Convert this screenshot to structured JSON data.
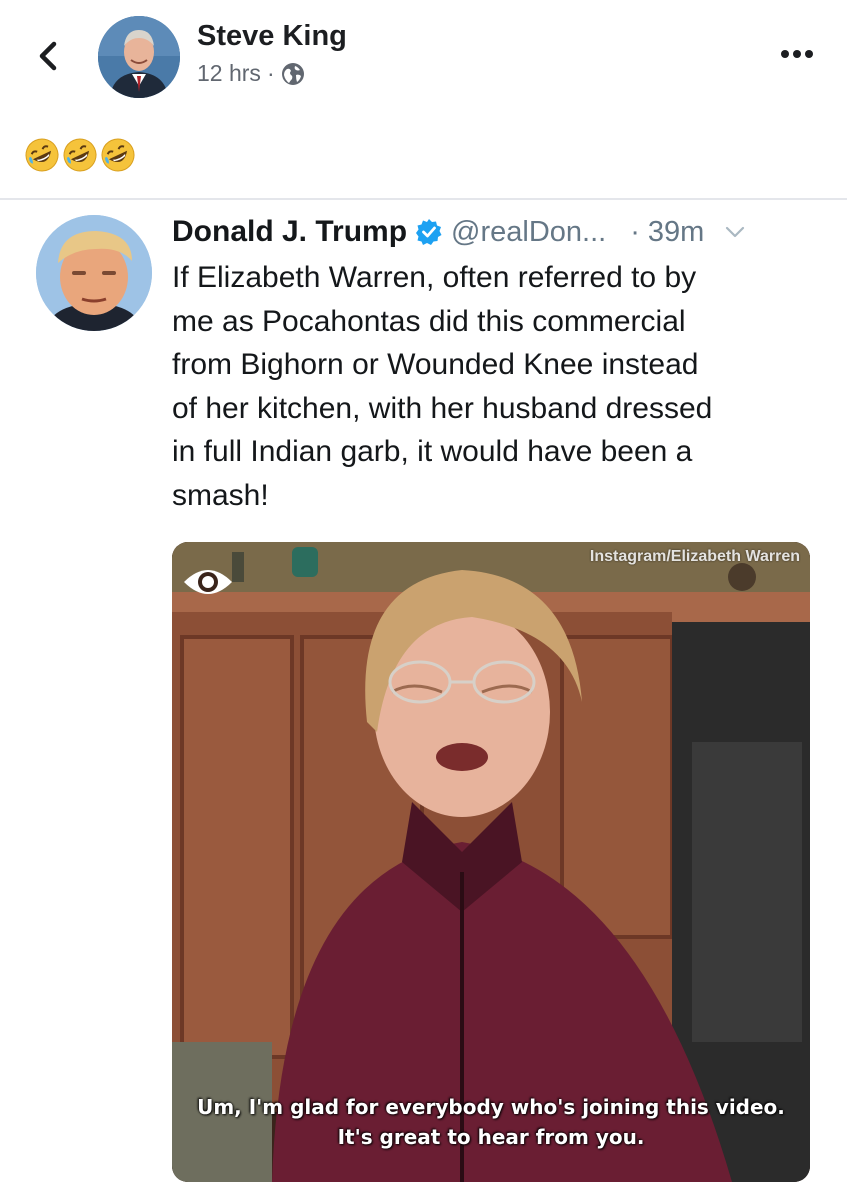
{
  "post": {
    "author": "Steve King",
    "time": "12 hrs",
    "separator": "·",
    "emojis": [
      "rolling-on-floor-laughing",
      "rolling-on-floor-laughing",
      "rolling-on-floor-laughing"
    ]
  },
  "icons": {
    "back": "chevron-left-icon",
    "privacy": "globe-icon",
    "more": "more-dots-icon",
    "verified": "verified-badge-icon",
    "menu": "chevron-down-icon"
  },
  "tweet": {
    "name": "Donald J. Trump",
    "handle": "@realDon...",
    "time": "· 39m",
    "text": "If Elizabeth Warren, often referred to by\nme as Pocahontas did this commercial\nfrom Bighorn or Wounded Knee instead\nof her kitchen, with her husband dressed\nin full Indian garb, it would have been a\nsmash!",
    "video": {
      "watermark": "Instagram/Elizabeth Warren",
      "caption_line1": "Um, I'm glad for everybody who's joining this video.",
      "caption_line2": "It's great to hear from you."
    }
  },
  "colors": {
    "verified": "#1da1f2",
    "secondary_text": "#657786",
    "fb_meta": "#616770"
  }
}
